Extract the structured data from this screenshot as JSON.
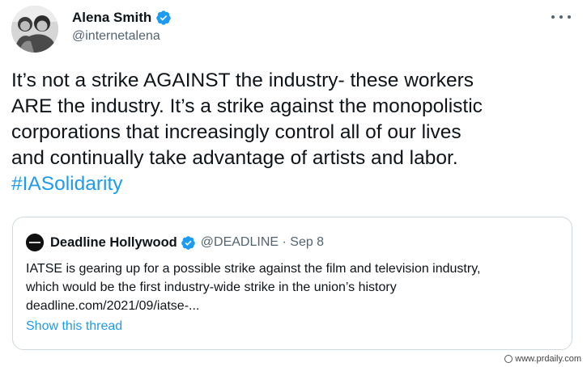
{
  "author": {
    "name": "Alena Smith",
    "handle": "@internetalena",
    "verified_icon": "verified-badge-icon"
  },
  "tweet": {
    "lines": [
      "It’s not a strike AGAINST the industry- these workers",
      "ARE the industry. It’s a strike against the monopolistic",
      "corporations that increasingly control all of our lives",
      "and continually take advantage of artists and labor."
    ],
    "hashtag": "#IASolidarity"
  },
  "quoted_tweet": {
    "name": "Deadline Hollywood",
    "handle_date": "@DEADLINE · Sep 8",
    "lines": [
      "IATSE is gearing up for a possible strike against the film and television industry,",
      "which would be the first industry-wide strike in the union’s history",
      "deadline.com/2021/09/iatse-..."
    ],
    "show_thread": "Show this thread"
  },
  "watermark": "www.prdaily.com",
  "colors": {
    "accent": "#1d9bf0",
    "text": "#0f1419",
    "muted": "#536471",
    "border": "#cfd9de"
  }
}
